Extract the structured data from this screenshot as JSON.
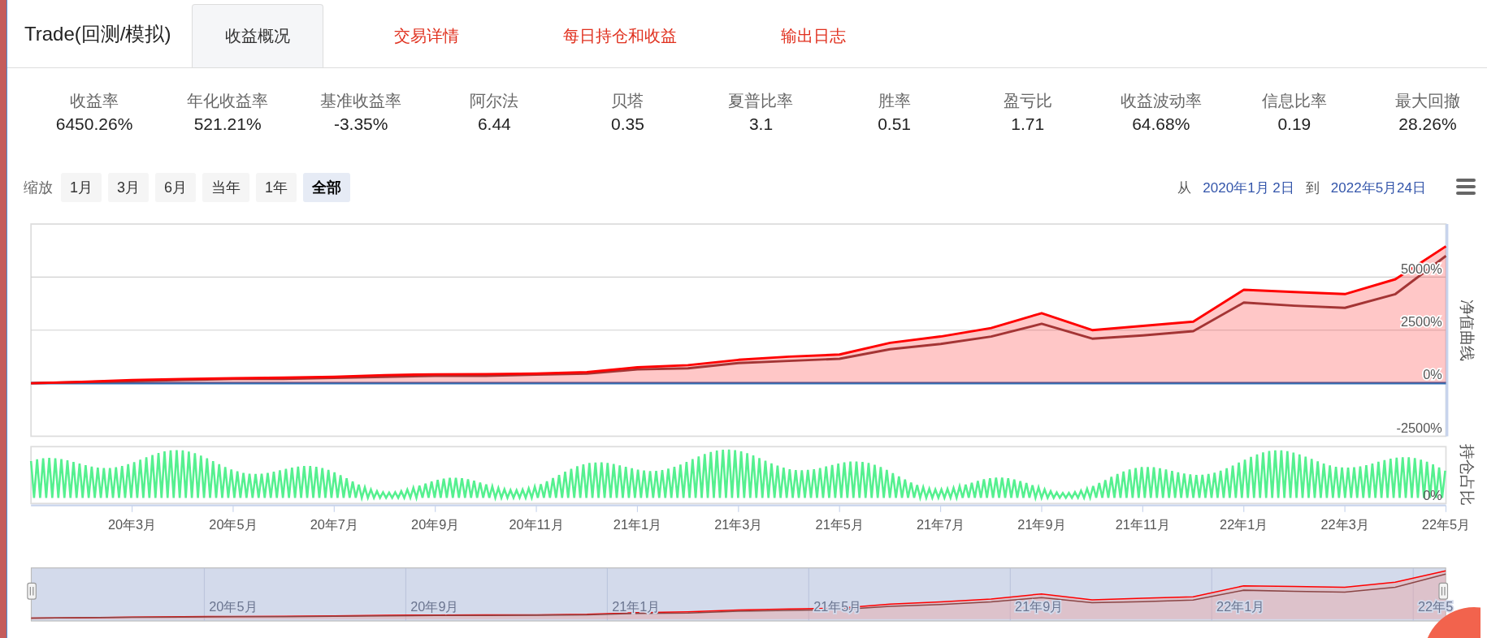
{
  "header": {
    "title": "Trade(回测/模拟)",
    "tabs": [
      {
        "label": "收益概况",
        "selected": true
      },
      {
        "label": "交易详情",
        "selected": false
      },
      {
        "label": "每日持仓和收益",
        "selected": false
      },
      {
        "label": "输出日志",
        "selected": false
      }
    ]
  },
  "stats": [
    {
      "label": "收益率",
      "value": "6450.26%"
    },
    {
      "label": "年化收益率",
      "value": "521.21%"
    },
    {
      "label": "基准收益率",
      "value": "-3.35%"
    },
    {
      "label": "阿尔法",
      "value": "6.44"
    },
    {
      "label": "贝塔",
      "value": "0.35"
    },
    {
      "label": "夏普比率",
      "value": "3.1"
    },
    {
      "label": "胜率",
      "value": "0.51"
    },
    {
      "label": "盈亏比",
      "value": "1.71"
    },
    {
      "label": "收益波动率",
      "value": "64.68%"
    },
    {
      "label": "信息比率",
      "value": "0.19"
    },
    {
      "label": "最大回撤",
      "value": "28.26%"
    }
  ],
  "range_bar": {
    "label": "缩放",
    "buttons": [
      {
        "label": "1月",
        "selected": false
      },
      {
        "label": "3月",
        "selected": false
      },
      {
        "label": "6月",
        "selected": false
      },
      {
        "label": "当年",
        "selected": false
      },
      {
        "label": "1年",
        "selected": false
      },
      {
        "label": "全部",
        "selected": true
      }
    ],
    "from_label": "从",
    "start_date": "2020年1月 2日",
    "to_label": "到",
    "end_date": "2022年5月24日"
  },
  "main_chart": {
    "axis_title": "净值曲线",
    "chart_data": {
      "type": "line",
      "categories": [
        null,
        null,
        "20年3月",
        null,
        "20年5月",
        null,
        "20年7月",
        null,
        "20年9月",
        null,
        "20年11月",
        null,
        "21年1月",
        null,
        "21年3月",
        null,
        "21年5月",
        null,
        "21年7月",
        null,
        "21年9月",
        null,
        "21年11月",
        null,
        "22年1月",
        null,
        "22年3月",
        null,
        "22年5月"
      ],
      "grid": true,
      "series": [
        {
          "color": "#ff0000",
          "values": [
            0,
            60,
            150,
            200,
            230,
            260,
            300,
            380,
            420,
            430,
            450,
            520,
            750,
            850,
            1100,
            1250,
            1350,
            1900,
            2200,
            2600,
            3300,
            2500,
            2700,
            2900,
            4400,
            4300,
            4200,
            4900,
            6450
          ]
        },
        {
          "color": "#8b4545",
          "values": [
            0,
            50,
            100,
            150,
            200,
            200,
            250,
            300,
            350,
            350,
            400,
            450,
            650,
            700,
            950,
            1050,
            1150,
            1600,
            1850,
            2200,
            2800,
            2100,
            2250,
            2450,
            3800,
            3650,
            3550,
            4200,
            6000
          ]
        },
        {
          "color": "#2e6db4",
          "values": [
            0,
            0,
            0,
            0,
            0,
            0,
            0,
            0,
            0,
            0,
            0,
            0,
            0,
            0,
            0,
            0,
            0,
            0,
            0,
            0,
            0,
            0,
            0,
            0,
            0,
            0,
            0,
            0,
            0
          ]
        }
      ],
      "ylim": [
        -2500,
        7500
      ],
      "yticks": [
        {
          "value": -2500,
          "label": "-2500%"
        },
        {
          "value": 0,
          "label": "0%"
        },
        {
          "value": 2500,
          "label": "2500%"
        },
        {
          "value": 5000,
          "label": "5000%"
        }
      ]
    }
  },
  "position_chart": {
    "axis_title": "持仓占比",
    "ytick": "0%"
  },
  "navigator": {
    "labels": [
      "20年5月",
      "20年9月",
      "21年1月",
      "21年5月",
      "21年9月",
      "22年1月",
      "22年5"
    ]
  }
}
